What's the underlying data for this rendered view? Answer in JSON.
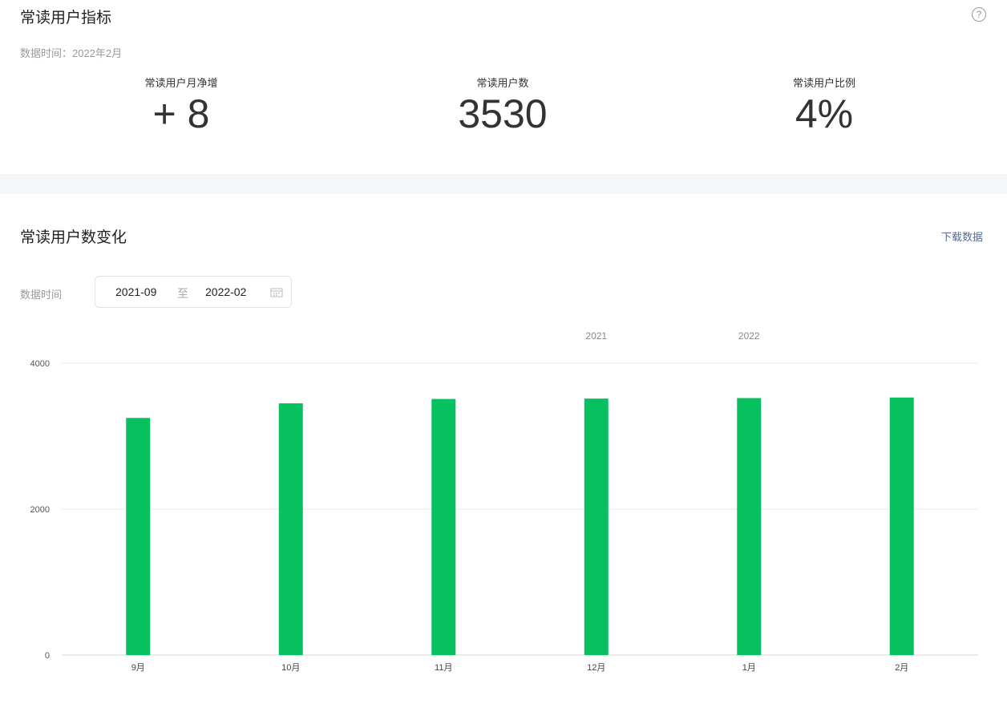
{
  "summary": {
    "title": "常读用户指标",
    "data_time": "数据时间：2022年2月",
    "metrics": [
      {
        "label": "常读用户月净增",
        "value": "+ 8"
      },
      {
        "label": "常读用户数",
        "value": "3530"
      },
      {
        "label": "常读用户比例",
        "value": "4%"
      }
    ]
  },
  "trend": {
    "title": "常读用户数变化",
    "download": "下载数据",
    "filter_label": "数据时间",
    "start": "2021-09",
    "separator": "至",
    "end": "2022-02"
  },
  "colors": {
    "bar": "#07c160",
    "link": "#576b95"
  },
  "chart_data": {
    "type": "bar",
    "title": "常读用户数变化",
    "categories": [
      "9月",
      "10月",
      "11月",
      "12月",
      "1月",
      "2月"
    ],
    "values": [
      3250,
      3450,
      3510,
      3515,
      3522,
      3530
    ],
    "year_labels": [
      {
        "text": "2021",
        "category_index": 3
      },
      {
        "text": "2022",
        "category_index": 4
      }
    ],
    "yticks": [
      0,
      2000,
      4000
    ],
    "ylim": [
      0,
      4000
    ],
    "grid": true,
    "xlabel": "",
    "ylabel": ""
  }
}
